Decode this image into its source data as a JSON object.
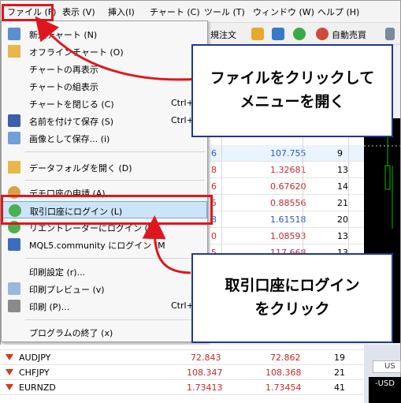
{
  "menubar": [
    "ファイル (F)",
    "表示 (V)",
    "挿入(I)",
    "チャート (C)",
    "ツール (T)",
    "ウィンドウ (W)",
    "ヘルプ (H)"
  ],
  "toolbar": {
    "new_order": "規注文",
    "auto_trade": "自動売買"
  },
  "menu": {
    "items": [
      {
        "label": "新規チャート (N)",
        "shortcut": ""
      },
      {
        "label": "オフラインチャート (O)",
        "shortcut": ""
      },
      {
        "label": "チャートの再表示",
        "shortcut": ""
      },
      {
        "label": "チャートの組表示",
        "shortcut": ""
      },
      {
        "label": "チャートを閉じる (C)",
        "shortcut": "Ctrl+"
      },
      {
        "label": "名前を付けて保存 (S)",
        "shortcut": "Ctrl+"
      },
      {
        "label": "画像として保存... (i)",
        "shortcut": ""
      },
      {
        "label": "データフォルダを開く (D)",
        "shortcut": ""
      },
      {
        "label": "デモ口座の申請 (A)",
        "shortcut": ""
      },
      {
        "label": "取引口座にログイン (L)",
        "shortcut": ""
      },
      {
        "label": "リエントレーダーにログイン (W)",
        "shortcut": ""
      },
      {
        "label": "MQL5.community にログイン (M",
        "shortcut": ""
      },
      {
        "label": "印刷設定 (r)...",
        "shortcut": ""
      },
      {
        "label": "印刷プレビュー (v)",
        "shortcut": ""
      },
      {
        "label": "印刷 (P)...",
        "shortcut": "Ctrl+"
      },
      {
        "label": "プログラムの終了 (x)",
        "shortcut": ""
      }
    ]
  },
  "grid_rows": [
    {
      "bid": "",
      "ask": "",
      "spread": ""
    },
    {
      "bid": "6",
      "ask": "107.755",
      "spread": "9"
    },
    {
      "bid": "8",
      "ask": "1.32681",
      "spread": "13"
    },
    {
      "bid": "6",
      "ask": "0.67620",
      "spread": "14"
    },
    {
      "bid": "5",
      "ask": "0.88556",
      "spread": "21"
    },
    {
      "bid": "8",
      "ask": "1.61518",
      "spread": "20"
    },
    {
      "bid": "0",
      "ask": "1.08593",
      "spread": "13"
    },
    {
      "bid": "5",
      "ask": "117.668",
      "spread": "13"
    }
  ],
  "bottom_rows": [
    {
      "symbol": "AUDJPY",
      "bid": "72.843",
      "ask": "72.862",
      "spread": "19"
    },
    {
      "symbol": "CHFJPY",
      "bid": "108.347",
      "ask": "108.368",
      "spread": "21"
    },
    {
      "symbol": "EURNZD",
      "bid": "1.73413",
      "ask": "1.73454",
      "spread": "41"
    }
  ],
  "chart_tab": "US",
  "chart_dark": "-USD",
  "callouts": {
    "top": "ファイルをクリックして\nメニューを開く",
    "bottom": "取引口座にログイン\nをクリック"
  }
}
